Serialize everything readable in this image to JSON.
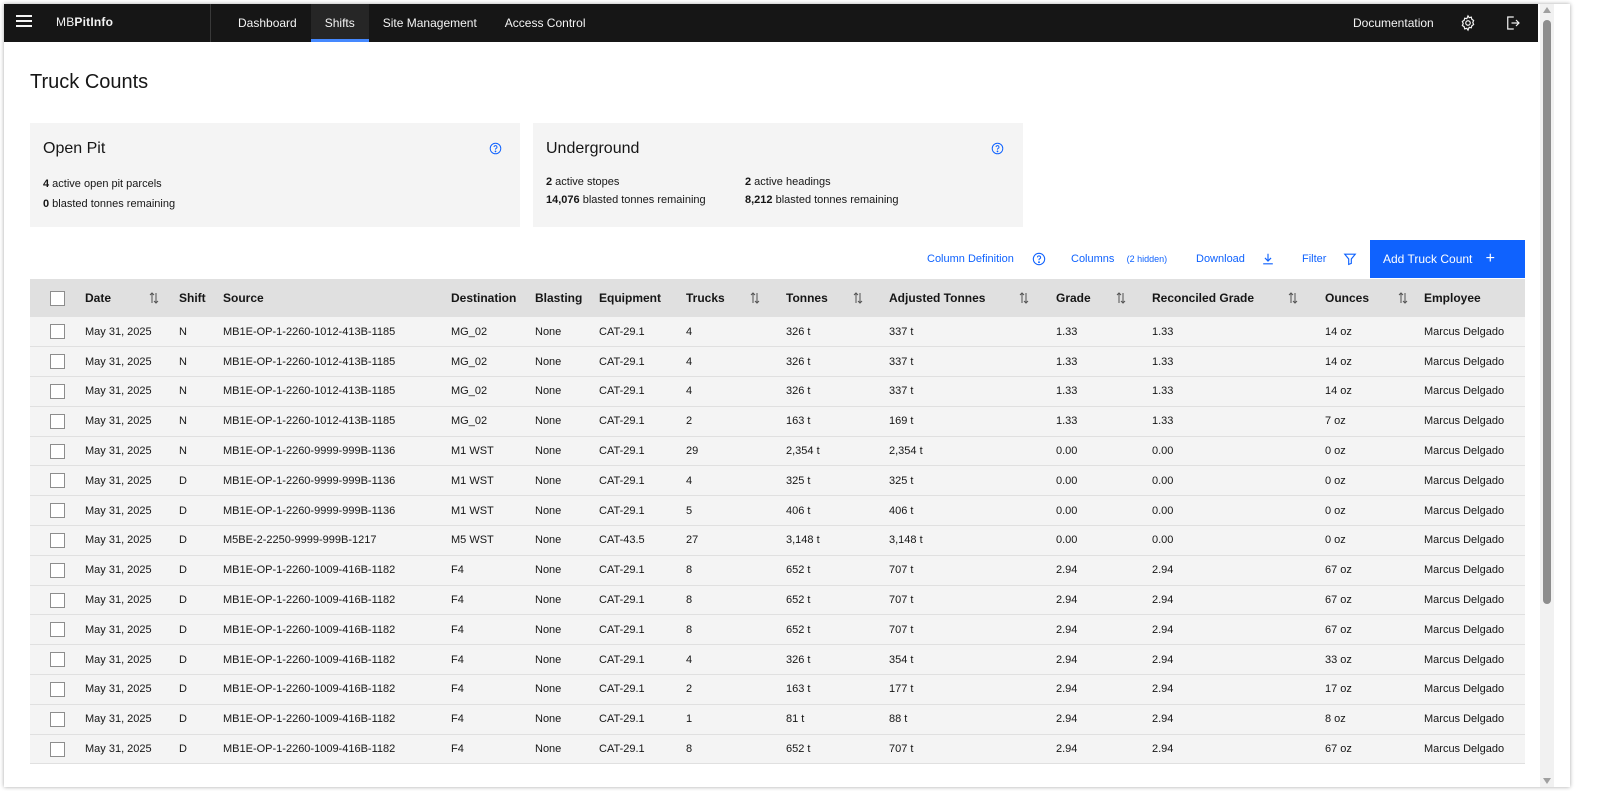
{
  "app": {
    "brand_prefix": "MB",
    "brand_suffix": "PitInfo",
    "nav": [
      "Dashboard",
      "Shifts",
      "Site Management",
      "Access Control"
    ],
    "active_nav": "Shifts",
    "documentation_label": "Documentation",
    "icons": [
      "menu-icon",
      "gear-icon",
      "logout-icon"
    ]
  },
  "page": {
    "title": "Truck Counts"
  },
  "cards": {
    "open_pit": {
      "title": "Open Pit",
      "stats": [
        {
          "value": "4",
          "label": " active open pit parcels"
        },
        {
          "value": "0",
          "label": " blasted tonnes remaining"
        }
      ]
    },
    "underground": {
      "title": "Underground",
      "stats_left": [
        {
          "value": "2",
          "label": " active stopes"
        },
        {
          "value": "14,076",
          "label": " blasted tonnes remaining"
        }
      ],
      "stats_right": [
        {
          "value": "2",
          "label": " active headings"
        },
        {
          "value": "8,212",
          "label": " blasted tonnes remaining"
        }
      ]
    }
  },
  "toolbar": {
    "column_definition": "Column Definition",
    "columns": "Columns",
    "columns_hidden": "(2 hidden)",
    "download": "Download",
    "filter": "Filter",
    "add_button": "Add Truck Count",
    "accent_color": "#0f62fe"
  },
  "table": {
    "headers": [
      "Date",
      "Shift",
      "Source",
      "Destination",
      "Blasting",
      "Equipment",
      "Trucks",
      "Tonnes",
      "Adjusted Tonnes",
      "Grade",
      "Reconciled Grade",
      "Ounces",
      "Employee"
    ],
    "sortable": [
      "Date",
      "Trucks",
      "Tonnes",
      "Adjusted Tonnes",
      "Grade",
      "Reconciled Grade",
      "Ounces"
    ],
    "rows": [
      [
        "May 31, 2025",
        "N",
        "MB1E-OP-1-2260-1012-413B-1185",
        "MG_02",
        "None",
        "CAT-29.1",
        "4",
        "326 t",
        "337 t",
        "1.33",
        "1.33",
        "14 oz",
        "Marcus Delgado"
      ],
      [
        "May 31, 2025",
        "N",
        "MB1E-OP-1-2260-1012-413B-1185",
        "MG_02",
        "None",
        "CAT-29.1",
        "4",
        "326 t",
        "337 t",
        "1.33",
        "1.33",
        "14 oz",
        "Marcus Delgado"
      ],
      [
        "May 31, 2025",
        "N",
        "MB1E-OP-1-2260-1012-413B-1185",
        "MG_02",
        "None",
        "CAT-29.1",
        "4",
        "326 t",
        "337 t",
        "1.33",
        "1.33",
        "14 oz",
        "Marcus Delgado"
      ],
      [
        "May 31, 2025",
        "N",
        "MB1E-OP-1-2260-1012-413B-1185",
        "MG_02",
        "None",
        "CAT-29.1",
        "2",
        "163 t",
        "169 t",
        "1.33",
        "1.33",
        "7 oz",
        "Marcus Delgado"
      ],
      [
        "May 31, 2025",
        "N",
        "MB1E-OP-1-2260-9999-999B-1136",
        "M1 WST",
        "None",
        "CAT-29.1",
        "29",
        "2,354 t",
        "2,354 t",
        "0.00",
        "0.00",
        "0 oz",
        "Marcus Delgado"
      ],
      [
        "May 31, 2025",
        "D",
        "MB1E-OP-1-2260-9999-999B-1136",
        "M1 WST",
        "None",
        "CAT-29.1",
        "4",
        "325 t",
        "325 t",
        "0.00",
        "0.00",
        "0 oz",
        "Marcus Delgado"
      ],
      [
        "May 31, 2025",
        "D",
        "MB1E-OP-1-2260-9999-999B-1136",
        "M1 WST",
        "None",
        "CAT-29.1",
        "5",
        "406 t",
        "406 t",
        "0.00",
        "0.00",
        "0 oz",
        "Marcus Delgado"
      ],
      [
        "May 31, 2025",
        "D",
        "M5BE-2-2250-9999-999B-1217",
        "M5 WST",
        "None",
        "CAT-43.5",
        "27",
        "3,148 t",
        "3,148 t",
        "0.00",
        "0.00",
        "0 oz",
        "Marcus Delgado"
      ],
      [
        "May 31, 2025",
        "D",
        "MB1E-OP-1-2260-1009-416B-1182",
        "F4",
        "None",
        "CAT-29.1",
        "8",
        "652 t",
        "707 t",
        "2.94",
        "2.94",
        "67 oz",
        "Marcus Delgado"
      ],
      [
        "May 31, 2025",
        "D",
        "MB1E-OP-1-2260-1009-416B-1182",
        "F4",
        "None",
        "CAT-29.1",
        "8",
        "652 t",
        "707 t",
        "2.94",
        "2.94",
        "67 oz",
        "Marcus Delgado"
      ],
      [
        "May 31, 2025",
        "D",
        "MB1E-OP-1-2260-1009-416B-1182",
        "F4",
        "None",
        "CAT-29.1",
        "8",
        "652 t",
        "707 t",
        "2.94",
        "2.94",
        "67 oz",
        "Marcus Delgado"
      ],
      [
        "May 31, 2025",
        "D",
        "MB1E-OP-1-2260-1009-416B-1182",
        "F4",
        "None",
        "CAT-29.1",
        "4",
        "326 t",
        "354 t",
        "2.94",
        "2.94",
        "33 oz",
        "Marcus Delgado"
      ],
      [
        "May 31, 2025",
        "D",
        "MB1E-OP-1-2260-1009-416B-1182",
        "F4",
        "None",
        "CAT-29.1",
        "2",
        "163 t",
        "177 t",
        "2.94",
        "2.94",
        "17 oz",
        "Marcus Delgado"
      ],
      [
        "May 31, 2025",
        "D",
        "MB1E-OP-1-2260-1009-416B-1182",
        "F4",
        "None",
        "CAT-29.1",
        "1",
        "81 t",
        "88 t",
        "2.94",
        "2.94",
        "8 oz",
        "Marcus Delgado"
      ],
      [
        "May 31, 2025",
        "D",
        "MB1E-OP-1-2260-1009-416B-1182",
        "F4",
        "None",
        "CAT-29.1",
        "8",
        "652 t",
        "707 t",
        "2.94",
        "2.94",
        "67 oz",
        "Marcus Delgado"
      ]
    ]
  }
}
